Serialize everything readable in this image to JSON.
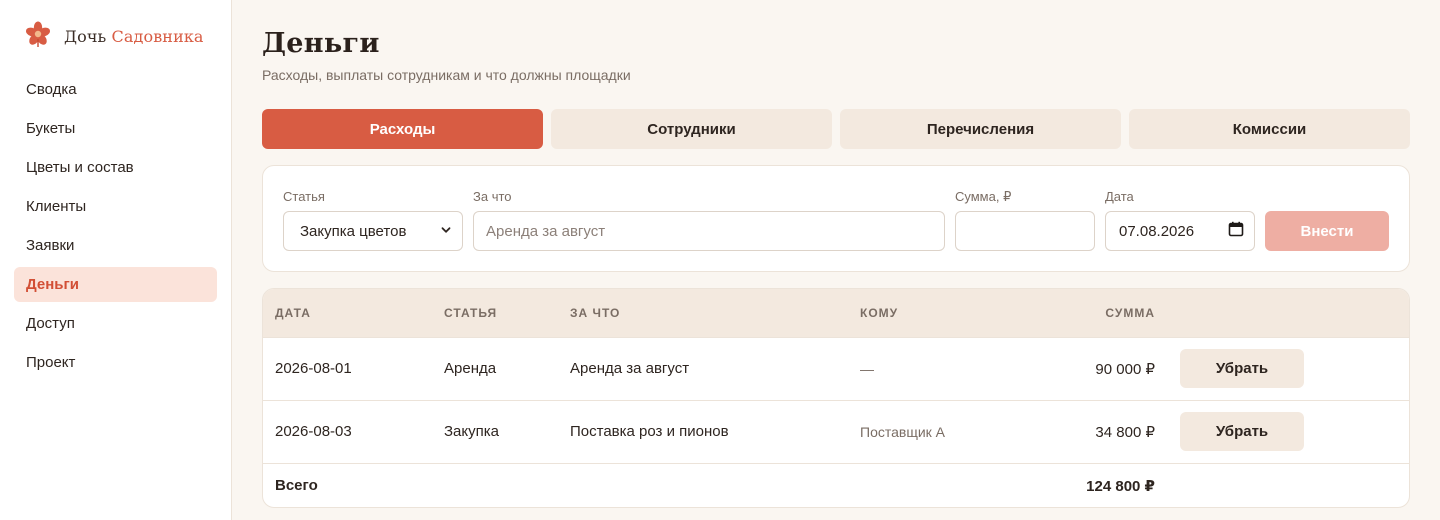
{
  "brand": {
    "name_part1": "Дочь",
    "name_part2": "Садовника",
    "accent": "#d85c43",
    "icon": "flower-icon"
  },
  "sidebar": {
    "items": [
      {
        "label": "Сводка"
      },
      {
        "label": "Букеты"
      },
      {
        "label": "Цветы и состав"
      },
      {
        "label": "Клиенты"
      },
      {
        "label": "Заявки"
      },
      {
        "label": "Деньги",
        "active": true
      },
      {
        "label": "Доступ"
      },
      {
        "label": "Проект"
      }
    ]
  },
  "header": {
    "title": "Деньги",
    "subtitle": "Расходы, выплаты сотрудникам и что должны площадки"
  },
  "tabs": [
    {
      "label": "Расходы",
      "active": true
    },
    {
      "label": "Сотрудники"
    },
    {
      "label": "Перечисления"
    },
    {
      "label": "Комиссии"
    }
  ],
  "form": {
    "category_label": "Статья",
    "category_value": "Закупка цветов",
    "purpose_label": "За что",
    "purpose_placeholder": "Аренда за август",
    "amount_label": "Сумма, ₽",
    "amount_value": "",
    "date_label": "Дата",
    "date_value": "07.08.2026",
    "submit_label": "Внести"
  },
  "table": {
    "columns": [
      "ДАТА",
      "СТАТЬЯ",
      "ЗА ЧТО",
      "КОМУ",
      "СУММА"
    ],
    "rows": [
      {
        "date": "2026-08-01",
        "category": "Аренда",
        "purpose": "Аренда за август",
        "recipient": "—",
        "amount": "90 000 ₽",
        "action": "Убрать"
      },
      {
        "date": "2026-08-03",
        "category": "Закупка",
        "purpose": "Поставка роз и пионов",
        "recipient": "Поставщик А",
        "amount": "34 800 ₽",
        "action": "Убрать"
      }
    ],
    "total_label": "Всего",
    "total_value": "124 800 ₽"
  }
}
